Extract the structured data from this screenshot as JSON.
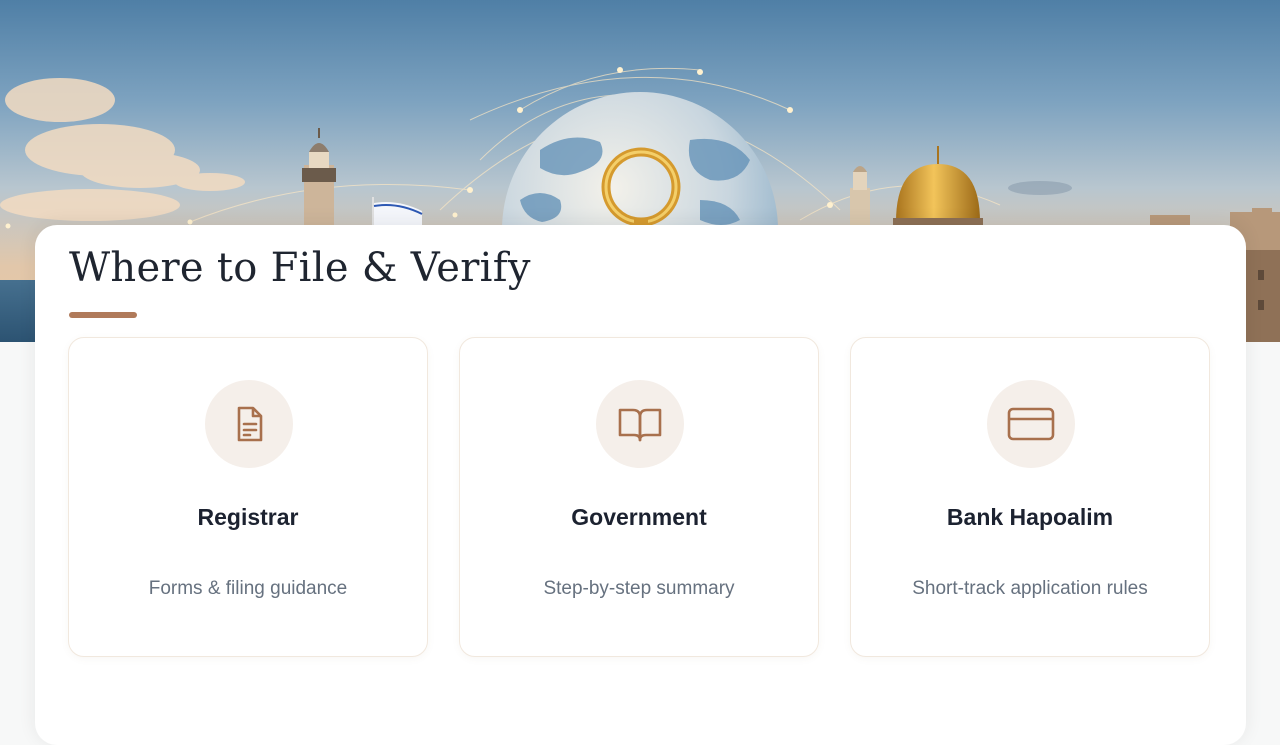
{
  "section": {
    "title": "Where to File & Verify"
  },
  "cards": [
    {
      "icon": "document-icon",
      "title": "Registrar",
      "subtitle": "Forms & filing guidance"
    },
    {
      "icon": "open-book-icon",
      "title": "Government",
      "subtitle": "Step-by-step summary"
    },
    {
      "icon": "credit-card-icon",
      "title": "Bank Hapoalim",
      "subtitle": "Short-track application rules"
    }
  ],
  "colors": {
    "accent": "#b07a5a",
    "icon_bg": "#f5efea",
    "heading": "#1f2530",
    "subtext": "#66717f"
  }
}
